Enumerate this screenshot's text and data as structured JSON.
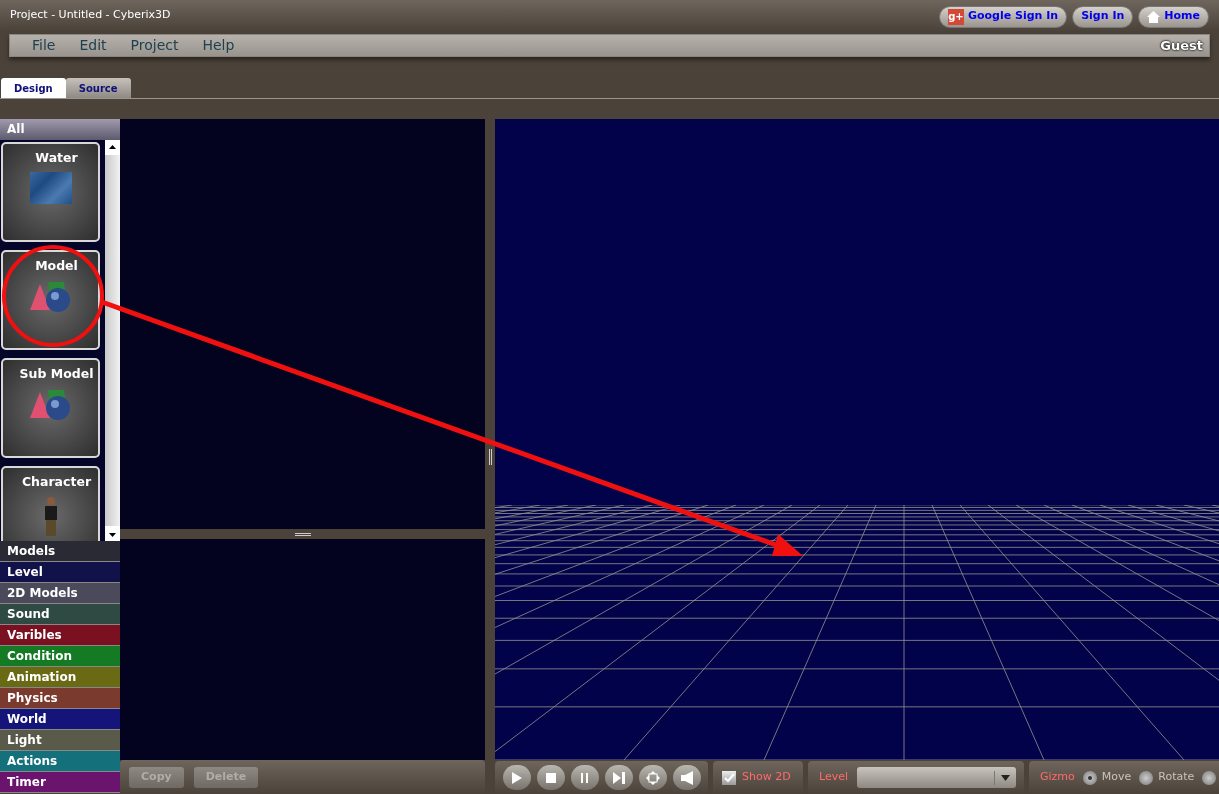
{
  "window": {
    "title": "Project - Untitled - Cyberix3D"
  },
  "header_buttons": [
    {
      "kind": "google",
      "icon": "g+",
      "label": "Google Sign In"
    },
    {
      "kind": "plain",
      "label": "Sign In"
    },
    {
      "kind": "home",
      "label": "Home"
    }
  ],
  "menu": [
    "File",
    "Edit",
    "Project",
    "Help"
  ],
  "user": "Guest",
  "tabs": [
    {
      "label": "Design",
      "selected": true
    },
    {
      "label": "Source",
      "selected": false
    }
  ],
  "palette": {
    "header": "All",
    "items": [
      {
        "label": "Water",
        "kind": "water"
      },
      {
        "label": "Model",
        "kind": "shapes"
      },
      {
        "label": "Sub Model",
        "kind": "shapes"
      },
      {
        "label": "Character",
        "kind": "character"
      }
    ]
  },
  "categories": [
    {
      "label": "Models",
      "color": "#2a2a34"
    },
    {
      "label": "Level",
      "color": "#12124a"
    },
    {
      "label": "2D Models",
      "color": "#4a4a5a"
    },
    {
      "label": "Sound",
      "color": "#2e4a42"
    },
    {
      "label": "Varibles",
      "color": "#7a1020"
    },
    {
      "label": "Condition",
      "color": "#147a24"
    },
    {
      "label": "Animation",
      "color": "#6a6a14"
    },
    {
      "label": "Physics",
      "color": "#7a3a2e"
    },
    {
      "label": "World",
      "color": "#14147a"
    },
    {
      "label": "Light",
      "color": "#5a5a4a"
    },
    {
      "label": "Actions",
      "color": "#14707a"
    },
    {
      "label": "Timer",
      "color": "#6a146e"
    }
  ],
  "edit_buttons": [
    "Copy",
    "Delete"
  ],
  "playback": [
    {
      "kind": "play"
    },
    {
      "kind": "stop"
    },
    {
      "kind": "pause"
    },
    {
      "kind": "step"
    },
    {
      "kind": "fullscreen"
    },
    {
      "kind": "sound"
    }
  ],
  "show_2d": {
    "label": "Show 2D",
    "checked": true
  },
  "level": {
    "label": "Level"
  },
  "gizmo": {
    "label": "Gizmo",
    "options": [
      {
        "label": "Move",
        "selected": true
      },
      {
        "label": "Rotate",
        "selected": false
      },
      {
        "selected": false
      }
    ]
  }
}
